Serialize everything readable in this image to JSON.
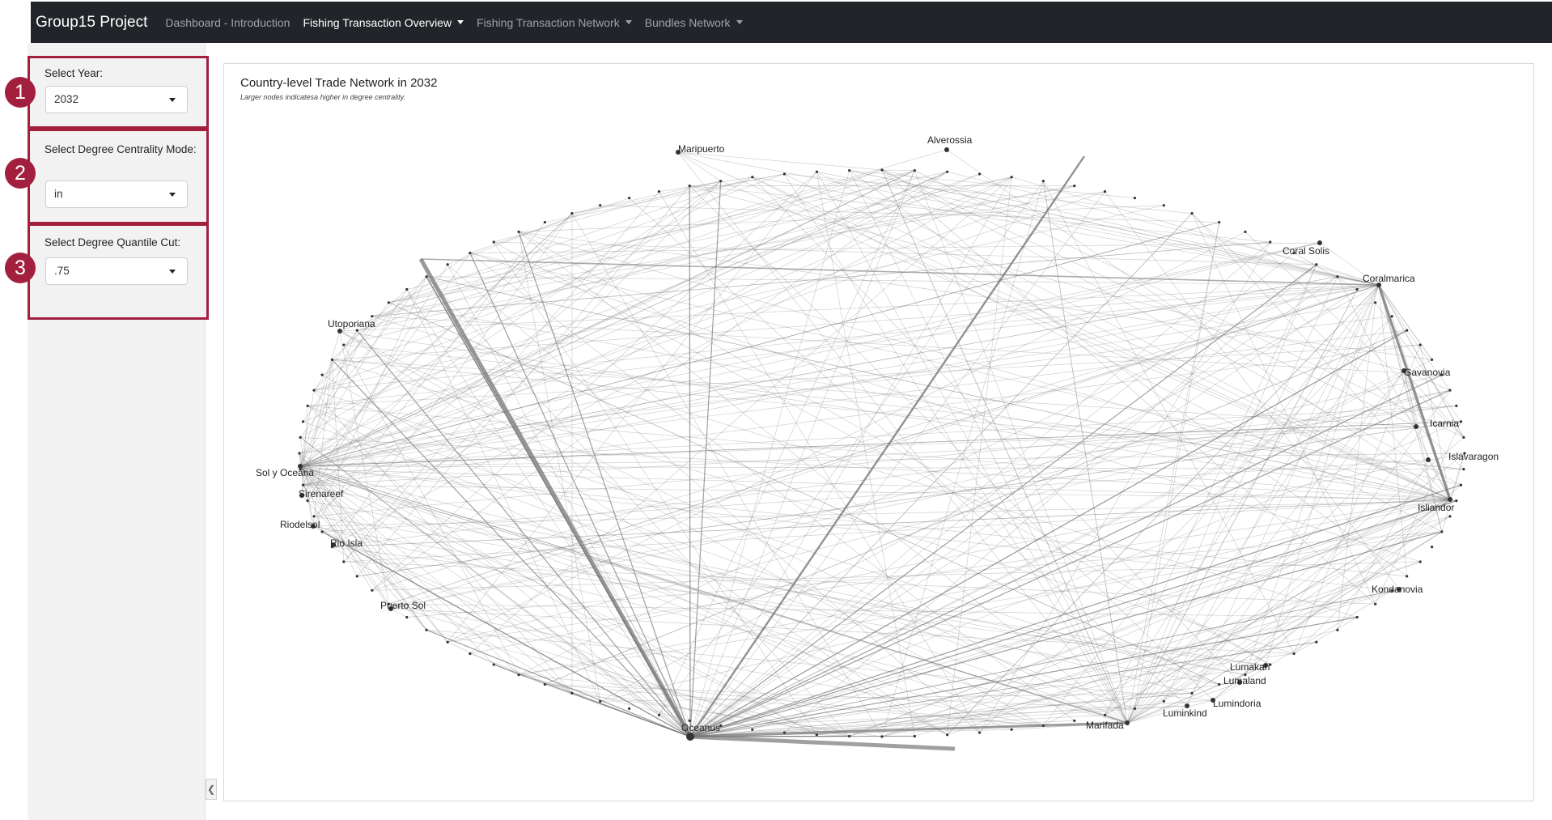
{
  "navbar": {
    "brand": "Group15 Project",
    "items": [
      {
        "label": "Dashboard - Introduction",
        "active": false,
        "dropdown": false
      },
      {
        "label": "Fishing Transaction Overview",
        "active": true,
        "dropdown": true
      },
      {
        "label": "Fishing Transaction Network",
        "active": false,
        "dropdown": true
      },
      {
        "label": "Bundles Network",
        "active": false,
        "dropdown": true
      }
    ]
  },
  "sidebar": {
    "year": {
      "badge": "1",
      "label": "Select Year:",
      "value": "2032"
    },
    "mode": {
      "badge": "2",
      "label": "Select Degree Centrality Mode:",
      "value": "in"
    },
    "cut": {
      "badge": "3",
      "label": "Select Degree Quantile Cut:",
      "value": ".75"
    }
  },
  "colors": {
    "navbar": "#212529",
    "badge": "#a31f3e",
    "edge": "#777777",
    "node": "#333333"
  },
  "chart": {
    "title": "Country-level Trade Network in 2032",
    "subtitle": "Larger nodes indicatesa higher in degree centrality.",
    "chart_data": {
      "type": "network",
      "layout": "circle",
      "labeled_nodes": [
        "Alverossia",
        "Maripuerto",
        "Coral Solis",
        "Coralmarica",
        "Utoporiana",
        "Gavanovia",
        "Icarnia",
        "Islavaragon",
        "Sol y Oceana",
        "Sirenareef",
        "Riodelsol",
        "Rio Isla",
        "Isliandor",
        "Puerto Sol",
        "Kondanovia",
        "Lumakari",
        "Lumaland",
        "Lumindoria",
        "Luminkind",
        "Marifada",
        "Oceanus"
      ]
    }
  }
}
